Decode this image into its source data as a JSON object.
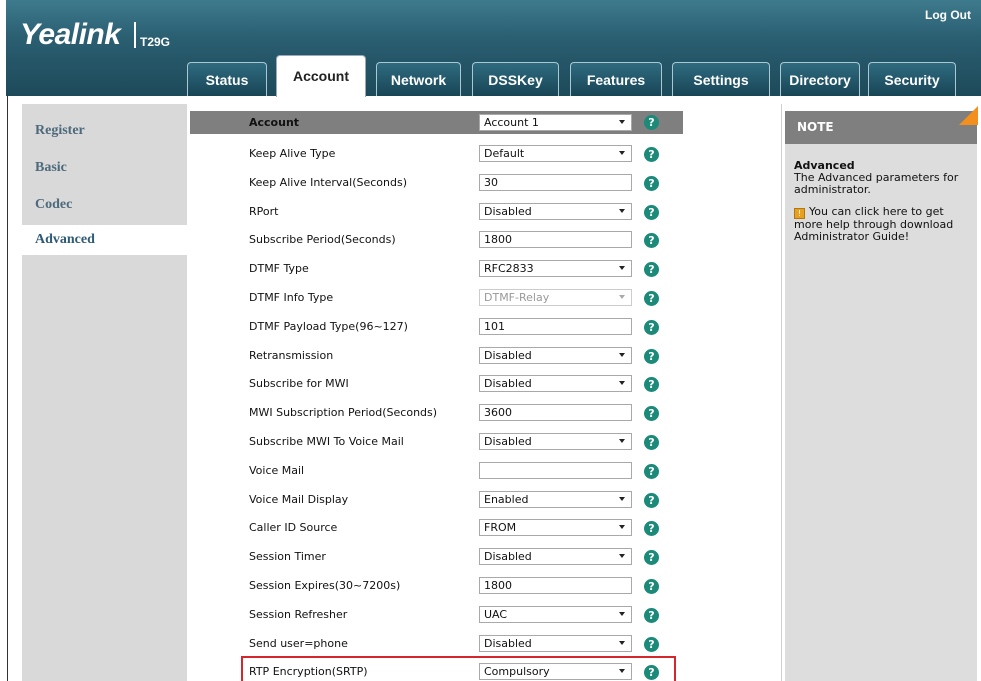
{
  "header": {
    "brand": "Yealink",
    "model": "T29G",
    "logout_label": "Log Out"
  },
  "tabs": [
    {
      "label": "Status",
      "active": false
    },
    {
      "label": "Account",
      "active": true
    },
    {
      "label": "Network",
      "active": false
    },
    {
      "label": "DSSKey",
      "active": false
    },
    {
      "label": "Features",
      "active": false
    },
    {
      "label": "Settings",
      "active": false
    },
    {
      "label": "Directory",
      "active": false
    },
    {
      "label": "Security",
      "active": false
    }
  ],
  "sidebar": {
    "items": [
      {
        "label": "Register",
        "active": false
      },
      {
        "label": "Basic",
        "active": false
      },
      {
        "label": "Codec",
        "active": false
      },
      {
        "label": "Advanced",
        "active": true
      }
    ]
  },
  "form": {
    "account_label": "Account",
    "account_value": "Account 1",
    "rows": [
      {
        "label": "Keep Alive Type",
        "type": "select",
        "value": "Default"
      },
      {
        "label": "Keep Alive Interval(Seconds)",
        "type": "text",
        "value": "30"
      },
      {
        "label": "RPort",
        "type": "select",
        "value": "Disabled"
      },
      {
        "label": "Subscribe Period(Seconds)",
        "type": "text",
        "value": "1800"
      },
      {
        "label": "DTMF Type",
        "type": "select",
        "value": "RFC2833"
      },
      {
        "label": "DTMF Info Type",
        "type": "select-disabled",
        "value": "DTMF-Relay"
      },
      {
        "label": "DTMF Payload Type(96~127)",
        "type": "text",
        "value": "101"
      },
      {
        "label": "Retransmission",
        "type": "select",
        "value": "Disabled"
      },
      {
        "label": "Subscribe for MWI",
        "type": "select",
        "value": "Disabled"
      },
      {
        "label": "MWI Subscription Period(Seconds)",
        "type": "text",
        "value": "3600"
      },
      {
        "label": "Subscribe MWI To Voice Mail",
        "type": "select",
        "value": "Disabled"
      },
      {
        "label": "Voice Mail",
        "type": "text",
        "value": ""
      },
      {
        "label": "Voice Mail Display",
        "type": "select",
        "value": "Enabled"
      },
      {
        "label": "Caller ID Source",
        "type": "select",
        "value": "FROM"
      },
      {
        "label": "Session Timer",
        "type": "select",
        "value": "Disabled"
      },
      {
        "label": "Session Expires(30~7200s)",
        "type": "text",
        "value": "1800"
      },
      {
        "label": "Session Refresher",
        "type": "select",
        "value": "UAC"
      },
      {
        "label": "Send user=phone",
        "type": "select",
        "value": "Disabled"
      },
      {
        "label": "RTP Encryption(SRTP)",
        "type": "select",
        "value": "Compulsory",
        "highlighted": true
      }
    ],
    "help_glyph": "?"
  },
  "note": {
    "title": "NOTE",
    "heading": "Advanced",
    "text": "The Advanced parameters for administrator.",
    "help_text": "You can click here to get more help through download Administrator Guide!",
    "accent_color": "#f3901d"
  },
  "colors": {
    "header_bar": "#2a5e71",
    "highlight_border": "#d6262d",
    "help_icon": "#1b8a78"
  }
}
